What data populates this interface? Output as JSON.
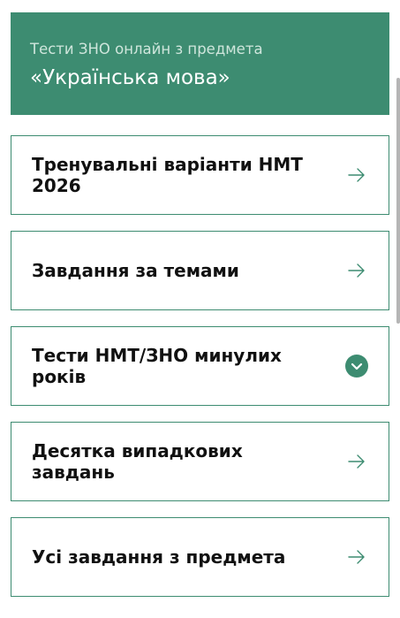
{
  "header": {
    "subtitle": "Тести ЗНО онлайн з предмета",
    "title": "«Українська мова»"
  },
  "accent_color": "#3d8c71",
  "cards": [
    {
      "label": "Тренувальні варіанти НМТ 2026",
      "icon": "arrow-right-icon"
    },
    {
      "label": "Завдання за темами",
      "icon": "arrow-right-icon"
    },
    {
      "label": "Тести НМТ/ЗНО минулих років",
      "icon": "chevron-down-icon"
    },
    {
      "label": "Десятка випадкових завдань",
      "icon": "arrow-right-icon"
    },
    {
      "label": "Усі завдання з предмета",
      "icon": "arrow-right-icon"
    }
  ]
}
